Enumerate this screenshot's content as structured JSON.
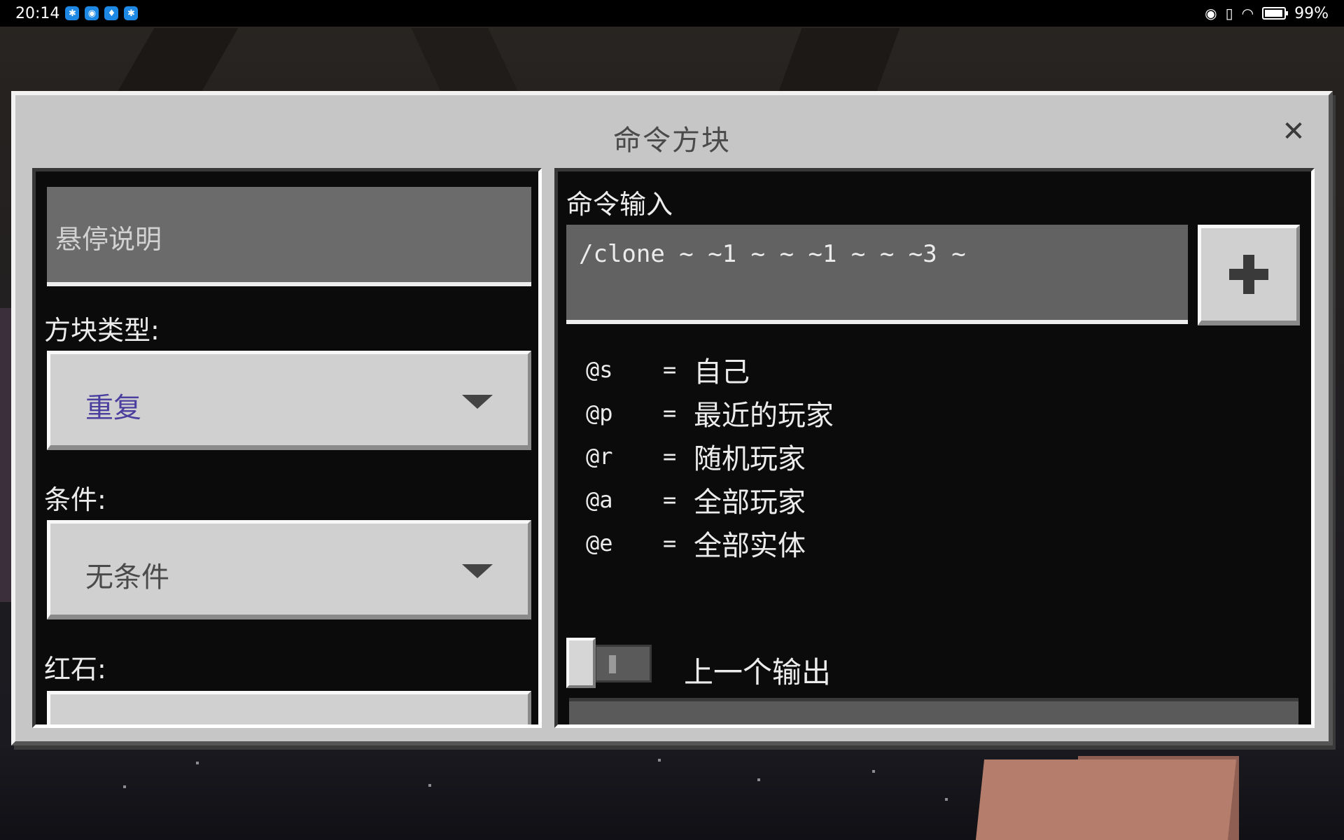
{
  "status_bar": {
    "time": "20:14",
    "app_icons": [
      "app-icon-1",
      "app-icon-2",
      "app-icon-3",
      "app-icon-4"
    ],
    "battery": "99%"
  },
  "dialog": {
    "title": "命令方块",
    "close_label": "✕"
  },
  "left": {
    "hover_placeholder": "悬停说明",
    "block_type_label": "方块类型:",
    "block_type_value": "重复",
    "condition_label": "条件:",
    "condition_value": "无条件",
    "redstone_label": "红石:"
  },
  "right": {
    "command_input_label": "命令输入",
    "command_value": "/clone ~ ~1 ~ ~ ~1 ~ ~ ~3 ~",
    "selectors": [
      {
        "key": "@s",
        "eq": "=",
        "desc": "自己"
      },
      {
        "key": "@p",
        "eq": "=",
        "desc": "最近的玩家"
      },
      {
        "key": "@r",
        "eq": "=",
        "desc": "随机玩家"
      },
      {
        "key": "@a",
        "eq": "=",
        "desc": "全部玩家"
      },
      {
        "key": "@e",
        "eq": "=",
        "desc": "全部实体"
      }
    ],
    "previous_output_label": "上一个输出"
  },
  "colors": {
    "block_type_value": "#4a3f9e",
    "condition_value": "#4a4a4a"
  }
}
